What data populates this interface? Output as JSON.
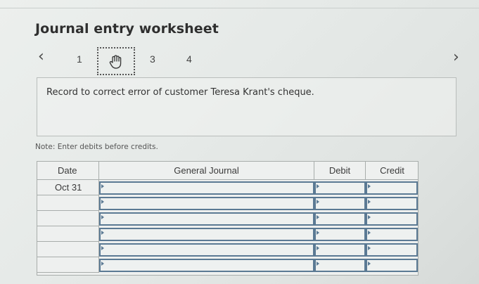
{
  "title": "Journal entry worksheet",
  "pagination": {
    "prev_icon": "chevron-left-icon",
    "next_icon": "chevron-right-icon",
    "pages": [
      "1",
      "3",
      "4"
    ],
    "current_icon": "hand-pointer-icon"
  },
  "instruction": "Record to correct error of customer Teresa Krant's cheque.",
  "note": "Note: Enter debits before credits.",
  "journal": {
    "columns": {
      "date": "Date",
      "general_journal": "General Journal",
      "debit": "Debit",
      "credit": "Credit"
    },
    "rows": [
      {
        "date": "Oct 31",
        "account": "",
        "debit": "",
        "credit": ""
      },
      {
        "date": "",
        "account": "",
        "debit": "",
        "credit": ""
      },
      {
        "date": "",
        "account": "",
        "debit": "",
        "credit": ""
      },
      {
        "date": "",
        "account": "",
        "debit": "",
        "credit": ""
      },
      {
        "date": "",
        "account": "",
        "debit": "",
        "credit": ""
      },
      {
        "date": "",
        "account": "",
        "debit": "",
        "credit": ""
      }
    ]
  },
  "colors": {
    "input_border": "#5b7a94",
    "grid_line": "#a8adab",
    "text": "#333333"
  }
}
